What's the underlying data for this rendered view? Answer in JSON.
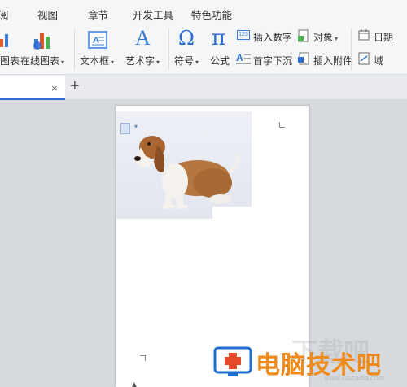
{
  "menu": {
    "tabs": [
      "阅",
      "视图",
      "章节",
      "开发工具",
      "特色功能"
    ]
  },
  "ribbon": {
    "chart_label": "图表",
    "online_chart_label": "在线图表",
    "textbox_label": "文本框",
    "wordart_label": "艺术字",
    "symbol_label": "符号",
    "formula_label": "公式",
    "insert_number_label": "插入数字",
    "object_label": "对象",
    "date_label": "日期",
    "dropcap_label": "首字下沉",
    "attachment_label": "插入附件",
    "field_label": "域",
    "number_icon_text": "123",
    "wordart_glyph": "A",
    "symbol_glyph": "Ω",
    "formula_glyph": "π"
  },
  "doc_tabs": {
    "close_glyph": "×",
    "new_glyph": "+"
  },
  "watermark": {
    "text": "电脑技术吧",
    "url": "www.xiazaiba.com",
    "ghost": "下载吧"
  },
  "colors": {
    "accent": "#2b6cd6",
    "watermark": "#f08a1a"
  }
}
